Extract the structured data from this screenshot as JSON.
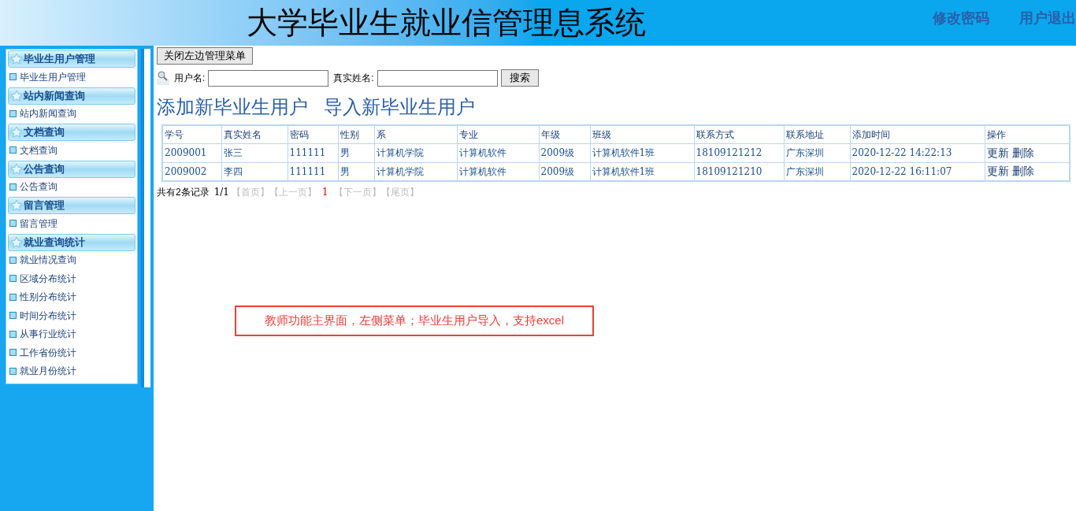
{
  "header": {
    "title": "大学毕业生就业信管理息系统",
    "links": [
      "修改密码",
      "用户退出"
    ]
  },
  "sidebar": {
    "groups": [
      {
        "title": "毕业生用户管理",
        "items": [
          "毕业生用户管理"
        ]
      },
      {
        "title": "站内新闻查询",
        "items": [
          "站内新闻查询"
        ]
      },
      {
        "title": "文档查询",
        "items": [
          "文档查询"
        ]
      },
      {
        "title": "公告查询",
        "items": [
          "公告查询"
        ]
      },
      {
        "title": "留言管理",
        "items": [
          "留言管理"
        ]
      },
      {
        "title": "就业查询统计",
        "items": [
          "就业情况查询",
          "区域分布统计",
          "性别分布统计",
          "时间分布统计",
          "从事行业统计",
          "工作省份统计",
          "就业月份统计"
        ]
      }
    ]
  },
  "toggle_button": "关闭左边管理菜单",
  "search": {
    "fields": [
      {
        "label": "用户名:"
      },
      {
        "label": "真实姓名:"
      }
    ],
    "button": "搜索"
  },
  "actions": [
    "添加新毕业生用户",
    "导入新毕业生用户"
  ],
  "table": {
    "columns": [
      "学号",
      "真实姓名",
      "密码",
      "性别",
      "系",
      "专业",
      "年级",
      "班级",
      "联系方式",
      "联系地址",
      "添加时间",
      "操作"
    ],
    "rows": [
      {
        "cells": [
          "2009001",
          "张三",
          "111111",
          "男",
          "计算机学院",
          "计算机软件",
          "2009级",
          "计算机软件1班",
          "18109121212",
          "广东深圳",
          "2020-12-22 14:22:13"
        ],
        "ops": [
          "更新",
          "删除"
        ]
      },
      {
        "cells": [
          "2009002",
          "李四",
          "111111",
          "男",
          "计算机学院",
          "计算机软件",
          "2009级",
          "计算机软件1班",
          "18109121210",
          "广东深圳",
          "2020-12-22 16:11:07"
        ],
        "ops": [
          "更新",
          "删除"
        ]
      }
    ]
  },
  "pagination": {
    "summary": "共有2条记录",
    "page_of": "1/1",
    "links": [
      {
        "label": "【首页】",
        "kind": "link"
      },
      {
        "label": "【上一页】",
        "kind": "link"
      },
      {
        "label": "1",
        "kind": "current"
      },
      {
        "label": "【下一页】",
        "kind": "link"
      },
      {
        "label": "【尾页】",
        "kind": "link"
      }
    ]
  },
  "annotation": "教师功能主界面，左侧菜单；毕业生用户导入，支持excel"
}
